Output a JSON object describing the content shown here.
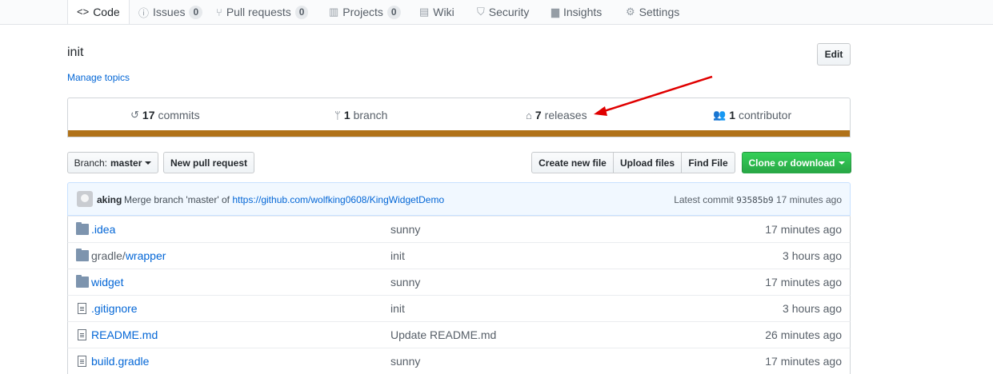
{
  "tabs": [
    {
      "label": "Code",
      "icon": "code-icon",
      "count": null,
      "selected": true
    },
    {
      "label": "Issues",
      "icon": "issue-icon",
      "count": "0"
    },
    {
      "label": "Pull requests",
      "icon": "pull-request-icon",
      "count": "0"
    },
    {
      "label": "Projects",
      "icon": "project-icon",
      "count": "0"
    },
    {
      "label": "Wiki",
      "icon": "book-icon",
      "count": null
    },
    {
      "label": "Security",
      "icon": "shield-icon",
      "count": null
    },
    {
      "label": "Insights",
      "icon": "graph-icon",
      "count": null
    },
    {
      "label": "Settings",
      "icon": "gear-icon",
      "count": null
    }
  ],
  "repo": {
    "description": "init",
    "manage_topics": "Manage topics",
    "edit_label": "Edit"
  },
  "summary": {
    "commits": {
      "num": "17",
      "label": "commits"
    },
    "branches": {
      "num": "1",
      "label": "branch"
    },
    "releases": {
      "num": "7",
      "label": "releases"
    },
    "contributors": {
      "num": "1",
      "label": "contributor"
    },
    "language_color": "#b07219"
  },
  "actions": {
    "branch_prefix": "Branch:",
    "branch_name": "master",
    "new_pull_request": "New pull request",
    "create_new_file": "Create new file",
    "upload_files": "Upload files",
    "find_file": "Find File",
    "clone_or_download": "Clone or download"
  },
  "latest_commit": {
    "author": "aking",
    "message_prefix": "Merge branch 'master' of",
    "message_link": "https://github.com/wolfking0608/KingWidgetDemo",
    "latest_label": "Latest commit",
    "sha": "93585b9",
    "age": "17 minutes ago"
  },
  "files": [
    {
      "type": "folder",
      "prefix": "",
      "name": ".idea",
      "message": "sunny",
      "age": "17 minutes ago"
    },
    {
      "type": "folder",
      "prefix": "gradle/",
      "name": "wrapper",
      "message": "init",
      "age": "3 hours ago"
    },
    {
      "type": "folder",
      "prefix": "",
      "name": "widget",
      "message": "sunny",
      "age": "17 minutes ago"
    },
    {
      "type": "file",
      "prefix": "",
      "name": ".gitignore",
      "message": "init",
      "age": "3 hours ago"
    },
    {
      "type": "file",
      "prefix": "",
      "name": "README.md",
      "message": "Update README.md",
      "age": "26 minutes ago"
    },
    {
      "type": "file",
      "prefix": "",
      "name": "build.gradle",
      "message": "sunny",
      "age": "17 minutes ago"
    }
  ],
  "annotation": {
    "color": "#e00000"
  }
}
